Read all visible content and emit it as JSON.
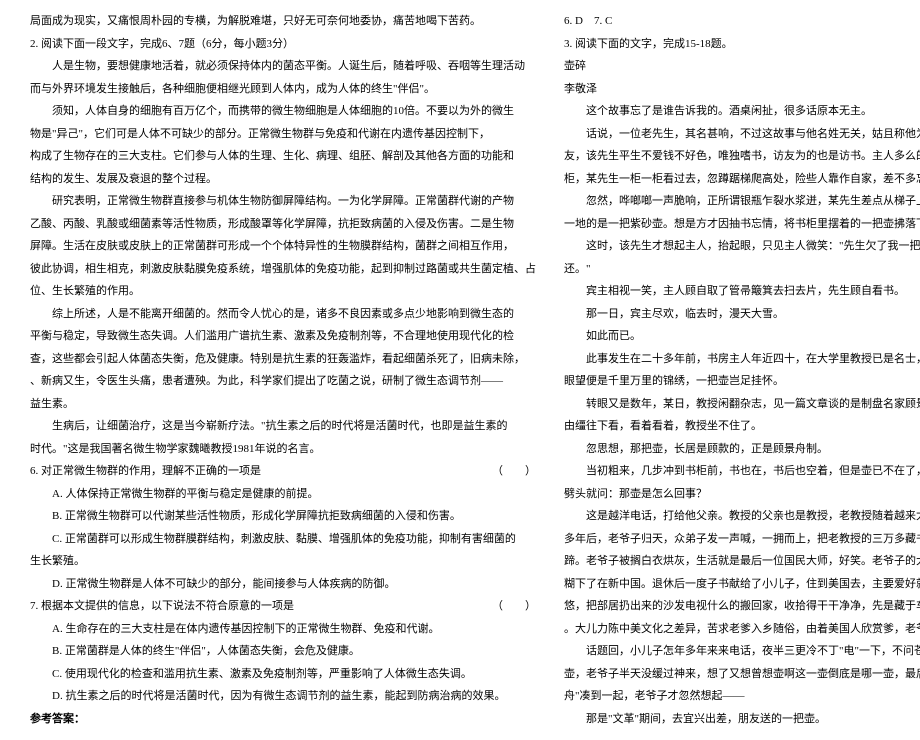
{
  "left": {
    "l1": "局面成为现实，又痛恨周朴园的专横，为解脱难堪，只好无可奈何地委协，痛苦地喝下苦药。",
    "l2": "2. 阅读下面一段文字，完成6、7题（6分，每小题3分）",
    "l3": "人是生物，要想健康地活着，就必须保持体内的菌态平衡。人诞生后，随着呼吸、吞咽等生理活动",
    "l4": "而与外界环境发生接触后，各种细胞便相继光顾到人体内，成为人体的终生\"伴侣\"。",
    "l5": "须知，人体自身的细胞有百万亿个，而携带的微生物细胞是人体细胞的10倍。不要以为外的微生",
    "l6": "物是\"异己\"，它们可是人体不可缺少的部分。正常微生物群与免疫和代谢在内遗传基因控制下，",
    "l7": "构成了生物存在的三大支柱。它们参与人体的生理、生化、病理、组胚、解剖及其他各方面的功能和",
    "l8": "结构的发生、发展及衰退的整个过程。",
    "l9": "研究表明，正常微生物群直接参与机体生物防御屏障结构。一为化学屏障。正常菌群代谢的产物",
    "l10": "乙酸、丙酸、乳酸或细菌素等活性物质，形成酸罩等化学屏障，抗拒致病菌的入侵及伤害。二是生物",
    "l11": "屏障。生活在皮肤或皮肤上的正常菌群可形成一个个体特异性的生物膜群结构，菌群之间相互作用，",
    "l12": "彼此协调，相生相克，刺激皮肤黏膜免疫系统，增强肌体的免疫功能，起到抑制过路菌或共生菌定植、占",
    "l13": "位、生长繁殖的作用。",
    "l14": "综上所述，人是不能离开细菌的。然而令人忧心的是，诸多不良因素或多点少地影响到微生态的",
    "l15": "平衡与稳定，导致微生态失调。人们滥用广谱抗生素、激素及免疫制剂等，不合理地使用现代化的检",
    "l16": "查，这些都会引起人体菌态失衡，危及健康。特别是抗生素的狂轰滥炸，看起细菌杀死了，旧病未除，",
    "l17": "、新病又生，令医生头痛，患者遭殃。为此，科学家们提出了吃菌之说，研制了微生态调节剂——",
    "l18": "益生素。",
    "l19": "生病后，让细菌治疗，这是当今崭新疗法。\"抗生素之后的时代将是活菌时代，也即是益生素的",
    "l20": "时代。\"这是我国著名微生物学家魏曦教授1981年说的名言。",
    "l21": "6. 对正常微生物群的作用，理解不正确的一项是",
    "l21b": "（　　）",
    "l22": "A. 人体保持正常微生物群的平衡与稳定是健康的前提。",
    "l23": "B. 正常微生物群可以代谢某些活性物质，形成化学屏障抗拒致病细菌的入侵和伤害。",
    "l24": "C. 正常菌群可以形成生物群膜群结构，刺激皮肤、黏膜、增强肌体的免疫功能，抑制有害细菌的",
    "l25": "生长繁殖。",
    "l26": "D. 正常微生物群是人体不可缺少的部分，能间接参与人体疾病的防御。",
    "l27": "7. 根据本文提供的信息，以下说法不符合原意的一项是",
    "l27b": "（　　）",
    "l28": "A. 生命存在的三大支柱是在体内遗传基因控制下的正常微生物群、免疫和代谢。",
    "l29": "B. 正常菌群是人体的终生\"伴侣\"，人体菌态失衡，会危及健康。",
    "l30": "C. 使用现代化的检查和滥用抗生素、激素及免疫制剂等，严重影响了人体微生态失调。",
    "l31": "D. 抗生素之后的时代将是活菌时代，因为有微生态调节剂的益生素，能起到防病治病的效果。",
    "ans_label": "参考答案：",
    "ans_blank": ""
  },
  "right": {
    "r1": "6. D　7. C",
    "r2": "3. 阅读下面的文字，完成15-18题。",
    "r3": "壶碎",
    "r4": "李敬泽",
    "r5": "这个故事忘了是谁告诉我的。酒桌闲扯，很多话原本无主。",
    "r6": "话说，一位老先生，其名甚响，不过这故事与他名姓无关，姑且称他为某先生。某日，某先生访",
    "r7": "友，该先生平生不爱钱不好色，唯独嗜书，访友为的也是访书。主人多么的客，差的正是书，房间里四面都是书",
    "r8": "柜，某先生一柜一柜看过去，忽蹲踞梯爬高处，险些人靠作自家，差不多忘了还有主人在。",
    "r9": "忽然，哗啷啷一声脆响，正所谓银瓶乍裂水浆迸，某先生差点从梯子上掉下来。定睛看时，碎了",
    "r10": "一地的是一把紫砂壶。想是方才因抽书忘情，将书柜里摆着的一把壶拂落下去。",
    "r11": "这时，该先生才想起主人，抬起眼，只见主人微笑：\"先生欠了我一把壶，日后要拿一瓶好酒来",
    "r12": "还。\"",
    "r13": "宾主相视一笑，主人顾自取了管帚簸箕去扫去片，先生顾自看书。",
    "r14": "那一日，宾主尽欢，临去时，漫天大雪。",
    "r15": "如此而已。",
    "r16": "此事发生在二十多年前，书房主人年近四十，在大学里教授已是名士，嗜傲江湖、踏花舞碎，抬",
    "r17": "眼望便是千里万里的锦绣，一把壶岂足挂怀。",
    "r18": "转眼又是数年，某日，教授闲翻杂志，见一篇文章谈的是制盘名家顾景舟，也是一时无聊，信马",
    "r19": "由缰往下看，看着看着，教授坐不住了。",
    "r20": "忽思想，那把壶，长居是顾款的，正是顾景舟制。",
    "r21": "当初粗来，几步冲到书柜前，书也在，书后也空着，但是壶已不在了，教授想了想，拿起电话，拨通了：",
    "r22": "劈头就问：那壶是怎么回事？",
    "r23": "这是越洋电话，打给他父亲。教授的父亲也是教授，老教授随着越来太太在美国的大儿子家住着——",
    "r24": "多年后，老爷子归天，众弟子发一声喊，一拥而上，把老教授的三万多藏书、回忆文化塞卷，三万连藏室臂",
    "r25": "蹄。老爷子被搁白衣烘灰，生活就是最后一位国民大师，好笑。老爷子的大学只在民国上了一年，",
    "r26": "糊下了在新中国。退休后一度子书献给了小儿子，住到美国去，主要爱好就是推个小车子在社区里转",
    "r27": "悠，把部居扔出来的沙发电视什么的搬回家，收拾得干干净净，先是藏于车库，渐渐蹲\"登堂入室\"",
    "r28": "。大儿力陈中美文化之差异，苦求老爹入乡随俗，由着美国人欣赏爹，老爷子只是不听耳朵。",
    "r29": "话题回，小儿子怎年多年来来电话，夜半三更冷不丁\"电\"一下，不问苍生问孤碑不问爹妈问茶",
    "r30": "壶，老爷子半天没缓过神来，想了又想曾想壶啊这一壶倒底是哪一壶，最后把\"紫砂\"\"宜兴\"\"顾景",
    "r31": "舟\"凑到一起，老爷子才忽然想起——",
    "r32": "那是\"文革\"期间，去宜兴出差，朋友送的一把壶。"
  }
}
